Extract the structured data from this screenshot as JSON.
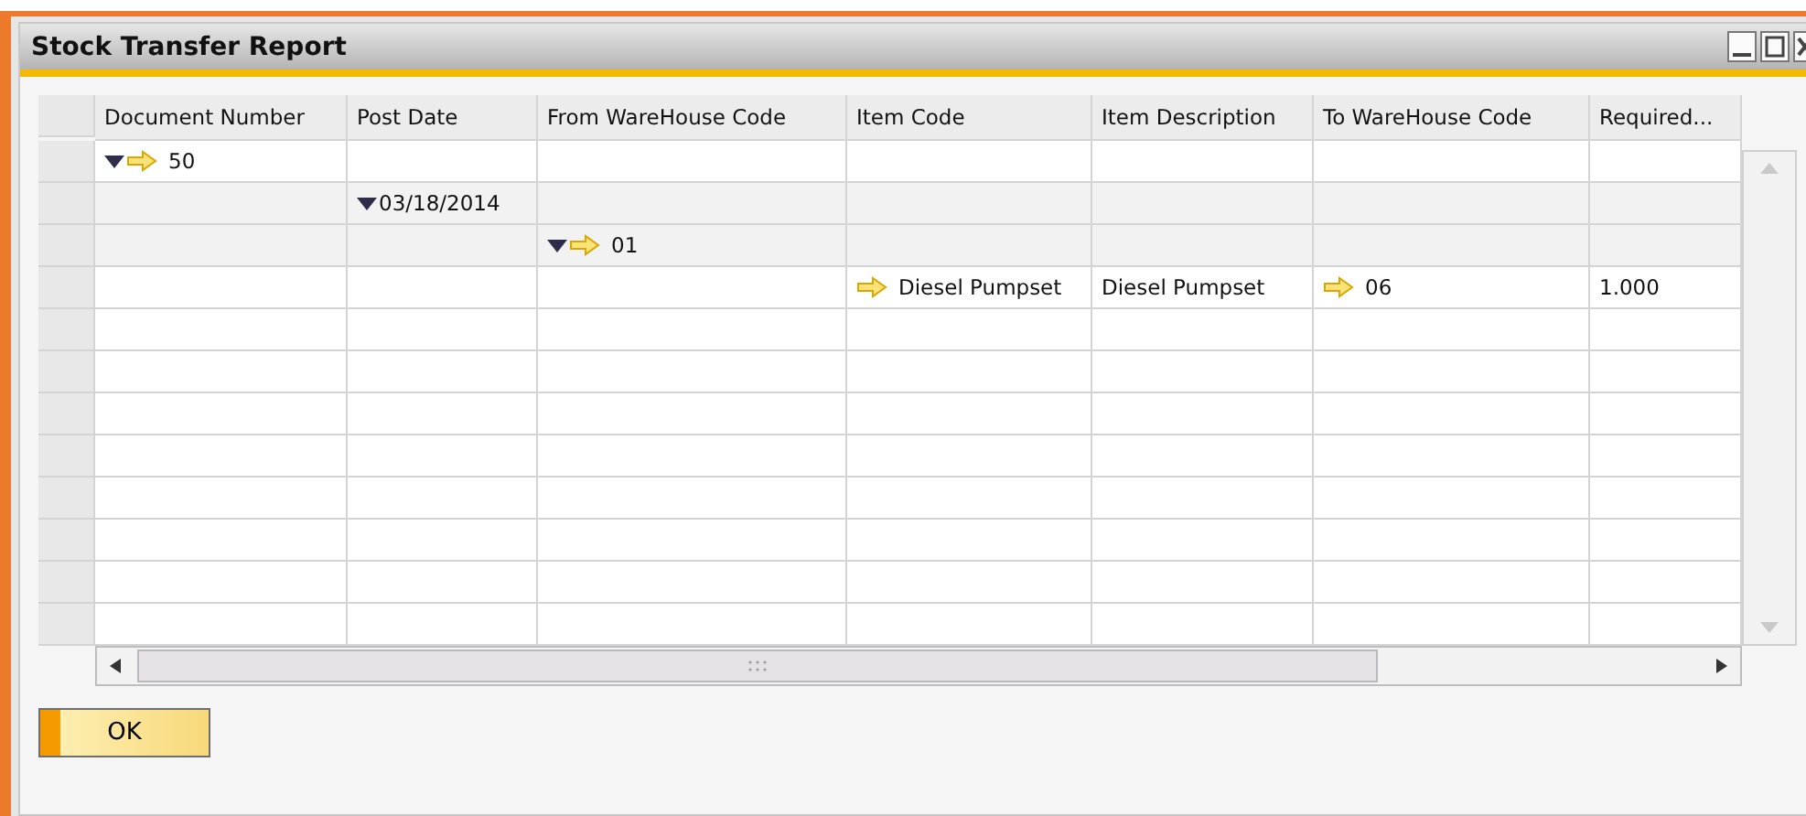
{
  "window": {
    "title": "Stock Transfer Report"
  },
  "table": {
    "columns": [
      "Document Number",
      "Post Date",
      "From WareHouse Code",
      "Item Code",
      "Item Description",
      "To WareHouse Code",
      "Required..."
    ],
    "rows": [
      {
        "shaded": false,
        "cells": [
          {
            "text": "50",
            "expanded": true,
            "link": true
          },
          null,
          null,
          null,
          null,
          null,
          null
        ]
      },
      {
        "shaded": true,
        "cells": [
          null,
          {
            "text": "03/18/2014",
            "expanded": true,
            "link": false
          },
          null,
          null,
          null,
          null,
          null
        ]
      },
      {
        "shaded": true,
        "cells": [
          null,
          null,
          {
            "text": "01",
            "expanded": true,
            "link": true
          },
          null,
          null,
          null,
          null
        ]
      },
      {
        "shaded": false,
        "cells": [
          null,
          null,
          null,
          {
            "text": "Diesel Pumpset",
            "link": true
          },
          {
            "text": "Diesel Pumpset",
            "link": false
          },
          {
            "text": "06",
            "link": true
          },
          {
            "text": "1.000",
            "link": false
          }
        ]
      }
    ]
  },
  "buttons": [
    {
      "label": "OK"
    }
  ]
}
